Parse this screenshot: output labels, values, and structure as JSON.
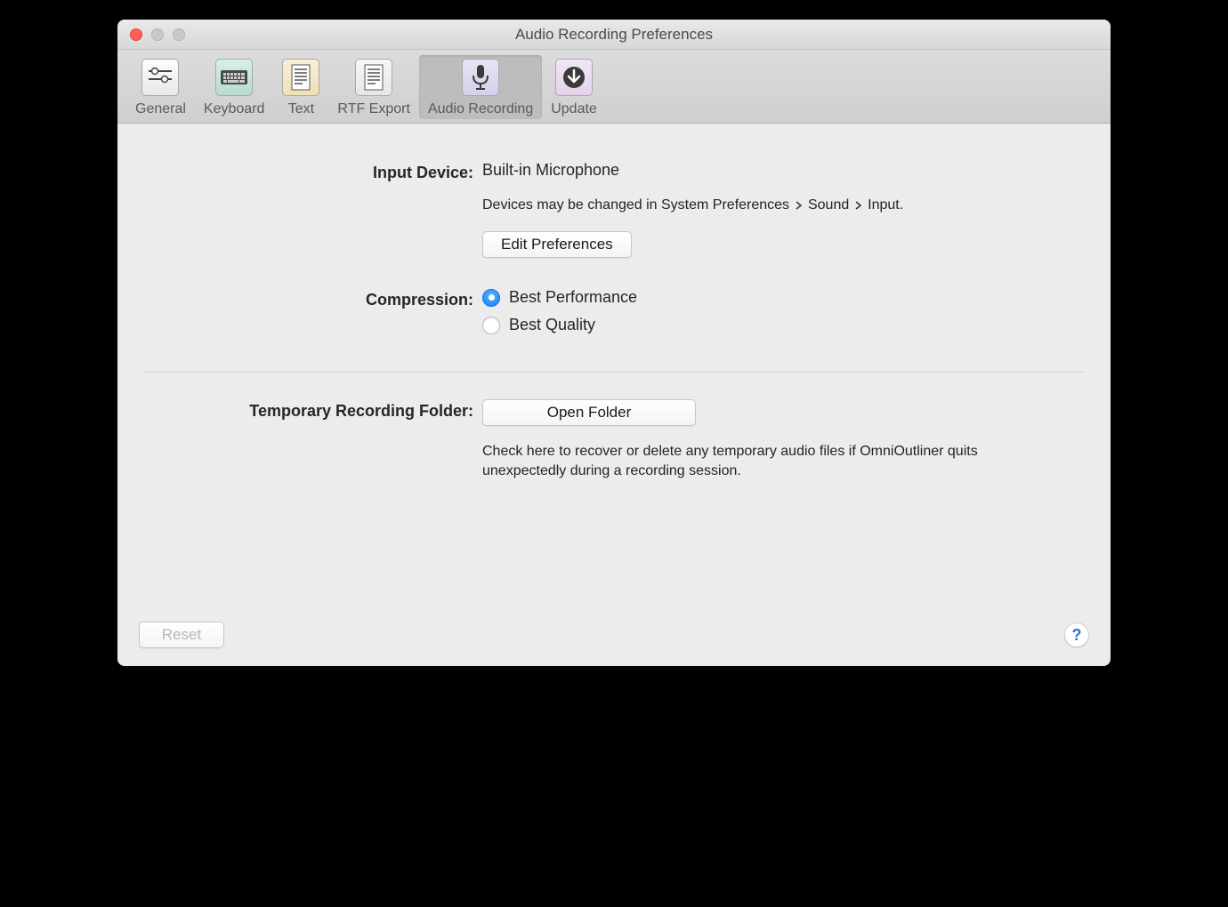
{
  "window": {
    "title": "Audio Recording Preferences"
  },
  "toolbar": {
    "items": [
      {
        "label": "General"
      },
      {
        "label": "Keyboard"
      },
      {
        "label": "Text"
      },
      {
        "label": "RTF Export"
      },
      {
        "label": "Audio Recording"
      },
      {
        "label": "Update"
      }
    ]
  },
  "input_device": {
    "label": "Input Device:",
    "value": "Built-in Microphone",
    "hint_prefix": "Devices may be changed in System Preferences",
    "hint_mid": "Sound",
    "hint_end": "Input.",
    "edit_button": "Edit Preferences"
  },
  "compression": {
    "label": "Compression:",
    "options": [
      {
        "label": "Best Performance",
        "checked": true
      },
      {
        "label": "Best Quality",
        "checked": false
      }
    ]
  },
  "folder": {
    "label": "Temporary Recording Folder:",
    "button": "Open Folder",
    "hint": "Check here to recover or delete any temporary audio files if OmniOutliner quits unexpectedly during a recording session."
  },
  "footer": {
    "reset": "Reset",
    "help": "?"
  }
}
